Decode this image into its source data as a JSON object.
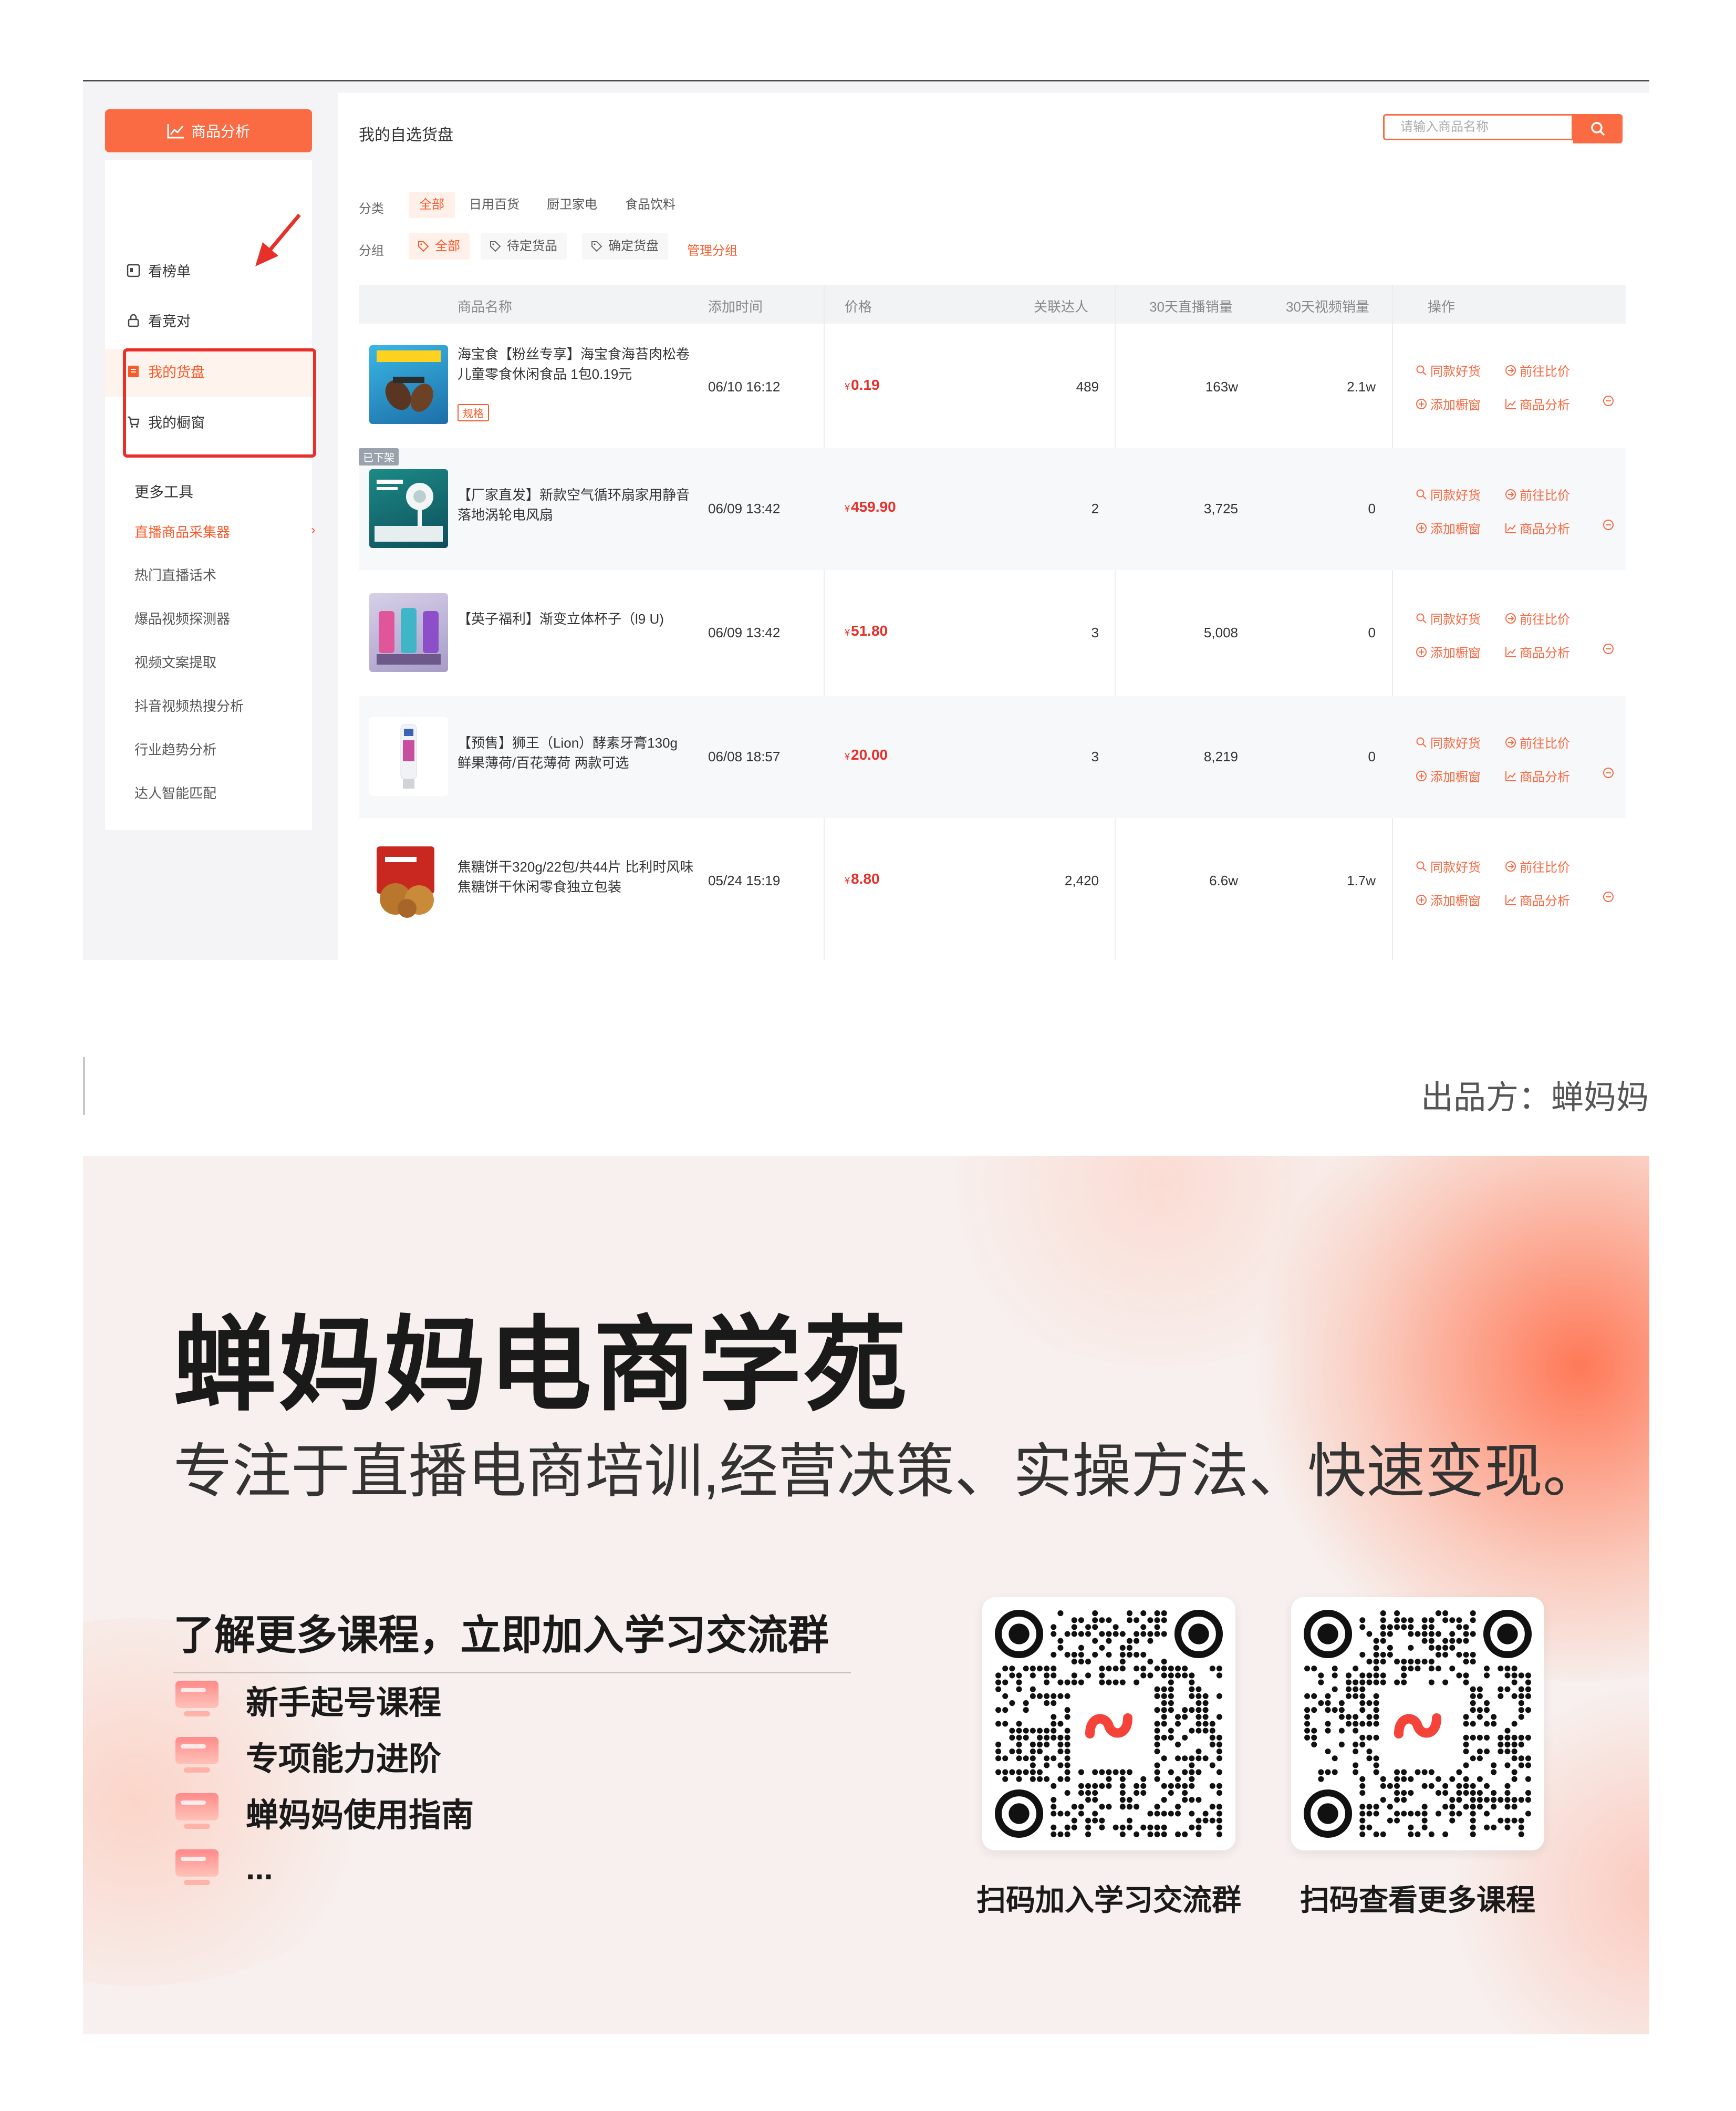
{
  "sidebar": {
    "analysis_button": "商品分析",
    "nav": [
      {
        "label": "看榜单"
      },
      {
        "label": "看竞对"
      },
      {
        "label": "我的货盘"
      },
      {
        "label": "我的橱窗"
      }
    ],
    "more_tools_title": "更多工具",
    "tools": [
      {
        "label": "直播商品采集器"
      },
      {
        "label": "热门直播话术"
      },
      {
        "label": "爆品视频探测器"
      },
      {
        "label": "视频文案提取"
      },
      {
        "label": "抖音视频热搜分析"
      },
      {
        "label": "行业趋势分析"
      },
      {
        "label": "达人智能匹配"
      }
    ],
    "chevron": "›"
  },
  "main": {
    "title": "我的自选货盘",
    "search_placeholder": "请输入商品名称",
    "category_label": "分类",
    "categories": [
      "全部",
      "日用百货",
      "厨卫家电",
      "食品饮料"
    ],
    "group_label": "分组",
    "groups": [
      "全部",
      "待定货品",
      "确定货盘"
    ],
    "manage_groups": "管理分组",
    "columns": [
      "商品名称",
      "添加时间",
      "价格",
      "关联达人",
      "30天直播销量",
      "30天视频销量",
      "操作"
    ],
    "ops": {
      "same": "同款好货",
      "compare": "前往比价",
      "add": "添加橱窗",
      "analyze": "商品分析"
    },
    "rows": [
      {
        "name": "海宝食【粉丝专享】海宝食海苔肉松卷儿童零食休闲食品 1包0.19元",
        "badge": "规格",
        "time": "06/10 16:12",
        "price_symbol": "¥",
        "price": "0.19",
        "influencers": "489",
        "live": "163w",
        "video": "2.1w"
      },
      {
        "name": "【厂家直发】新款空气循环扇家用静音落地涡轮电风扇",
        "offshelf": "已下架",
        "time": "06/09 13:42",
        "price_symbol": "¥",
        "price": "459.90",
        "influencers": "2",
        "live": "3,725",
        "video": "0"
      },
      {
        "name": "【英子福利】渐变立体杯子（l9 U)",
        "time": "06/09 13:42",
        "price_symbol": "¥",
        "price": "51.80",
        "influencers": "3",
        "live": "5,008",
        "video": "0"
      },
      {
        "name": "【预售】狮王（Lion）酵素牙膏130g 鲜果薄荷/百花薄荷 两款可选",
        "time": "06/08 18:57",
        "price_symbol": "¥",
        "price": "20.00",
        "influencers": "3",
        "live": "8,219",
        "video": "0"
      },
      {
        "name": "焦糖饼干320g/22包/共44片 比利时风味焦糖饼干休闲零食独立包装",
        "time": "05/24 15:19",
        "price_symbol": "¥",
        "price": "8.80",
        "influencers": "2,420",
        "live": "6.6w",
        "video": "1.7w"
      }
    ]
  },
  "producer": "出品方：蝉妈妈",
  "banner": {
    "title": "蝉妈妈电商学苑",
    "subtitle": "专注于直播电商培训,经营决策、实操方法、快速变现。",
    "cta": "了解更多课程，立即加入学习交流群",
    "courses": [
      "新手起号课程",
      "专项能力进阶",
      "蝉妈妈使用指南",
      "..."
    ],
    "qr_captions": [
      "扫码加入学习交流群",
      "扫码查看更多课程"
    ]
  },
  "colors": {
    "accent": "#fa6a43",
    "price": "#e8302a",
    "highlight_box": "#e8302a"
  }
}
